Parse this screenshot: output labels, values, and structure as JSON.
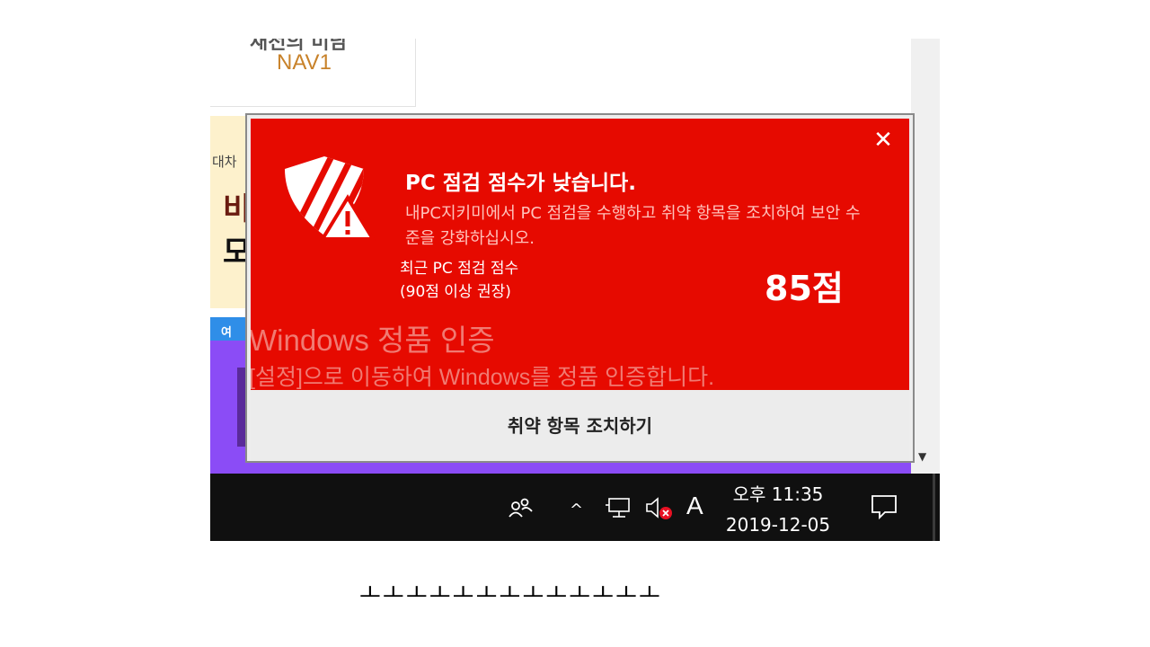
{
  "background_page": {
    "ad_top_text": "새천의 미남",
    "ad_nav_text": "NAV1",
    "promo_small": "대차",
    "promo_big1": "비",
    "promo_big2": "모",
    "blue_strip_text": "여"
  },
  "popup": {
    "title": "PC 점검 점수가 낮습니다.",
    "description": "내PC지키미에서 PC 점검을 수행하고 취약 항목을 조치하여 보안 수준을 강화하십시오.",
    "score_label_line1": "최근 PC 점검 점수",
    "score_label_line2": "(90점 이상 권장)",
    "score_value": "85점",
    "action_button_label": "취약 항목 조치하기",
    "close_icon": "close-icon",
    "logo_icon": "shield-warning-icon",
    "colors": {
      "panel": "#e60a00",
      "button": "#ececec"
    }
  },
  "watermark": {
    "title": "Windows 정품 인증",
    "subtitle": "[설정]으로 이동하여 Windows를 정품 인증합니다."
  },
  "taskbar": {
    "icons": [
      "people-icon",
      "chevron-up-icon",
      "network-icon",
      "volume-muted-icon",
      "notification-icon"
    ],
    "chevron": "^",
    "ime_indicator": "A",
    "time": "오후 11:35",
    "date": "2019-12-05"
  },
  "caption": "ㅗㅗㅗㅗㅗㅗㅗㅗㅗㅗㅗㅗㅗ"
}
